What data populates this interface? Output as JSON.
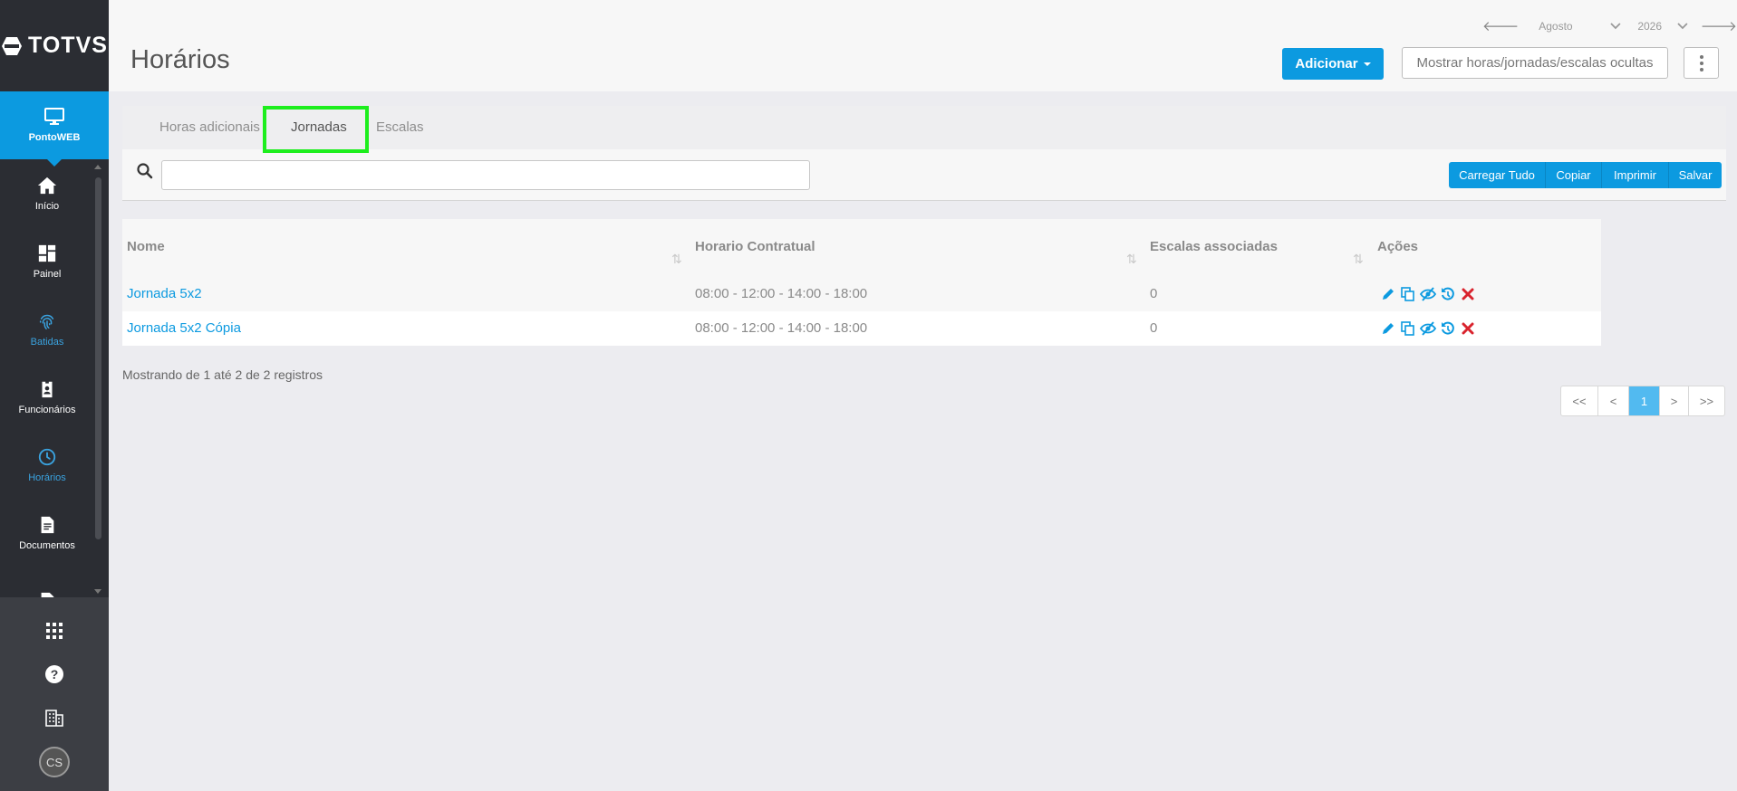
{
  "sidebar": {
    "logo": "TOTVS",
    "app": {
      "label": "PontoWEB",
      "icon": "monitor-icon"
    },
    "items": [
      {
        "label": "Início",
        "icon": "home-icon",
        "active": false
      },
      {
        "label": "Painel",
        "icon": "dashboard-icon",
        "active": false
      },
      {
        "label": "Batidas",
        "icon": "fingerprint-icon",
        "active": true
      },
      {
        "label": "Funcionários",
        "icon": "badge-icon",
        "active": false
      },
      {
        "label": "Horários",
        "icon": "clock-icon",
        "active": true
      },
      {
        "label": "Documentos",
        "icon": "document-icon",
        "active": false
      }
    ],
    "bottom": {
      "avatar": "CS"
    }
  },
  "header": {
    "title": "Horários",
    "month": "Agosto",
    "year": "2026",
    "add_label": "Adicionar",
    "hidden_label": "Mostrar horas/jornadas/escalas ocultas"
  },
  "tabs": [
    {
      "label": "Horas adicionais",
      "active": false
    },
    {
      "label": "Jornadas",
      "active": true
    },
    {
      "label": "Escalas",
      "active": false
    }
  ],
  "search": {
    "placeholder": ""
  },
  "actions": [
    "Carregar Tudo",
    "Copiar",
    "Imprimir",
    "Salvar"
  ],
  "table": {
    "columns": [
      "Nome",
      "Horario Contratual",
      "Escalas associadas",
      "Ações"
    ],
    "rows": [
      {
        "name": "Jornada 5x2",
        "schedule": "08:00 - 12:00 - 14:00 - 18:00",
        "scales": "0"
      },
      {
        "name": "Jornada 5x2 Cópia",
        "schedule": "08:00 - 12:00 - 14:00 - 18:00",
        "scales": "0"
      }
    ]
  },
  "info": "Mostrando de 1 até 2 de 2 registros",
  "pagination": {
    "first": "<<",
    "prev": "<",
    "current": "1",
    "next": ">",
    "last": ">>"
  },
  "colors": {
    "accent": "#0c9ae0",
    "sidebar": "#2b2d33",
    "highlight": "#1dee1d",
    "danger": "#d9232d"
  }
}
